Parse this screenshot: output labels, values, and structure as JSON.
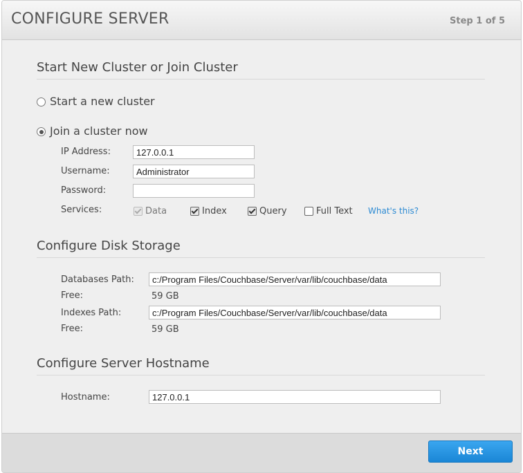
{
  "header": {
    "title": "CONFIGURE SERVER",
    "step": "Step 1 of 5"
  },
  "cluster": {
    "section_title": "Start New Cluster or Join Cluster",
    "option_new": {
      "label": "Start a new cluster",
      "selected": false
    },
    "option_join": {
      "label": "Join a cluster now",
      "selected": true
    },
    "ip_label": "IP Address:",
    "ip_value": "127.0.0.1",
    "username_label": "Username:",
    "username_value": "Administrator",
    "password_label": "Password:",
    "password_value": "",
    "services_label": "Services:",
    "services": [
      {
        "label": "Data",
        "checked": true,
        "disabled": true
      },
      {
        "label": "Index",
        "checked": true,
        "disabled": false
      },
      {
        "label": "Query",
        "checked": true,
        "disabled": false
      },
      {
        "label": "Full Text",
        "checked": false,
        "disabled": false
      }
    ],
    "whats_this": "What's this?"
  },
  "disk": {
    "section_title": "Configure Disk Storage",
    "db_path_label": "Databases Path:",
    "db_path_value": "c:/Program Files/Couchbase/Server/var/lib/couchbase/data",
    "db_free_label": "Free:",
    "db_free_value": "59 GB",
    "idx_path_label": "Indexes Path:",
    "idx_path_value": "c:/Program Files/Couchbase/Server/var/lib/couchbase/data",
    "idx_free_label": "Free:",
    "idx_free_value": "59 GB"
  },
  "hostname": {
    "section_title": "Configure Server Hostname",
    "label": "Hostname:",
    "value": "127.0.0.1"
  },
  "footer": {
    "next_label": "Next"
  },
  "colors": {
    "accent": "#2e8bd3",
    "button": "#1a86d6"
  }
}
